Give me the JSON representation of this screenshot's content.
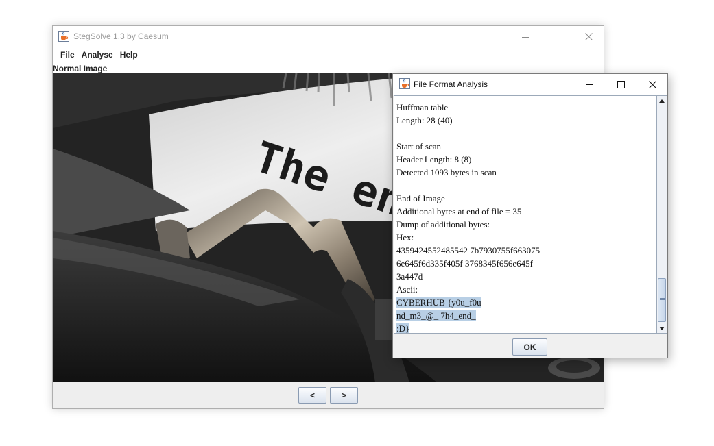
{
  "main_window": {
    "title": "StegSolve 1.3 by Caesum",
    "menu": [
      "File",
      "Analyse",
      "Help"
    ],
    "image_label": "Normal Image",
    "image_text": "The en",
    "nav_prev": "<",
    "nav_next": ">"
  },
  "dialog": {
    "title": "File Format Analysis",
    "lines": [
      "Huffman table",
      "Length: 28 (40)",
      "",
      "Start of scan",
      "Header Length: 8 (8)",
      "Detected 1093 bytes in scan",
      "",
      "End of Image",
      "Additional bytes at end of file = 35",
      "Dump of additional bytes:",
      "Hex:",
      "4359424552485542 7b7930755f663075",
      "6e645f6d335f405f 3768345f656e645f",
      "3a447d",
      "Ascii:",
      "CYBERHUB {y0u_f0u",
      "nd_m3_@_ 7h4_end_",
      ":D}"
    ],
    "selected_lines": [
      15,
      16,
      17
    ],
    "ok_label": "OK"
  },
  "icons": {
    "app": "java-cup-icon",
    "minimize": "minimize-icon",
    "maximize": "maximize-icon",
    "close": "close-icon",
    "scroll_up": "scroll-up-arrow-icon",
    "scroll_down": "scroll-down-arrow-icon"
  },
  "colors": {
    "selection": "#b8cfe5",
    "button_border": "#8a9bb2"
  }
}
